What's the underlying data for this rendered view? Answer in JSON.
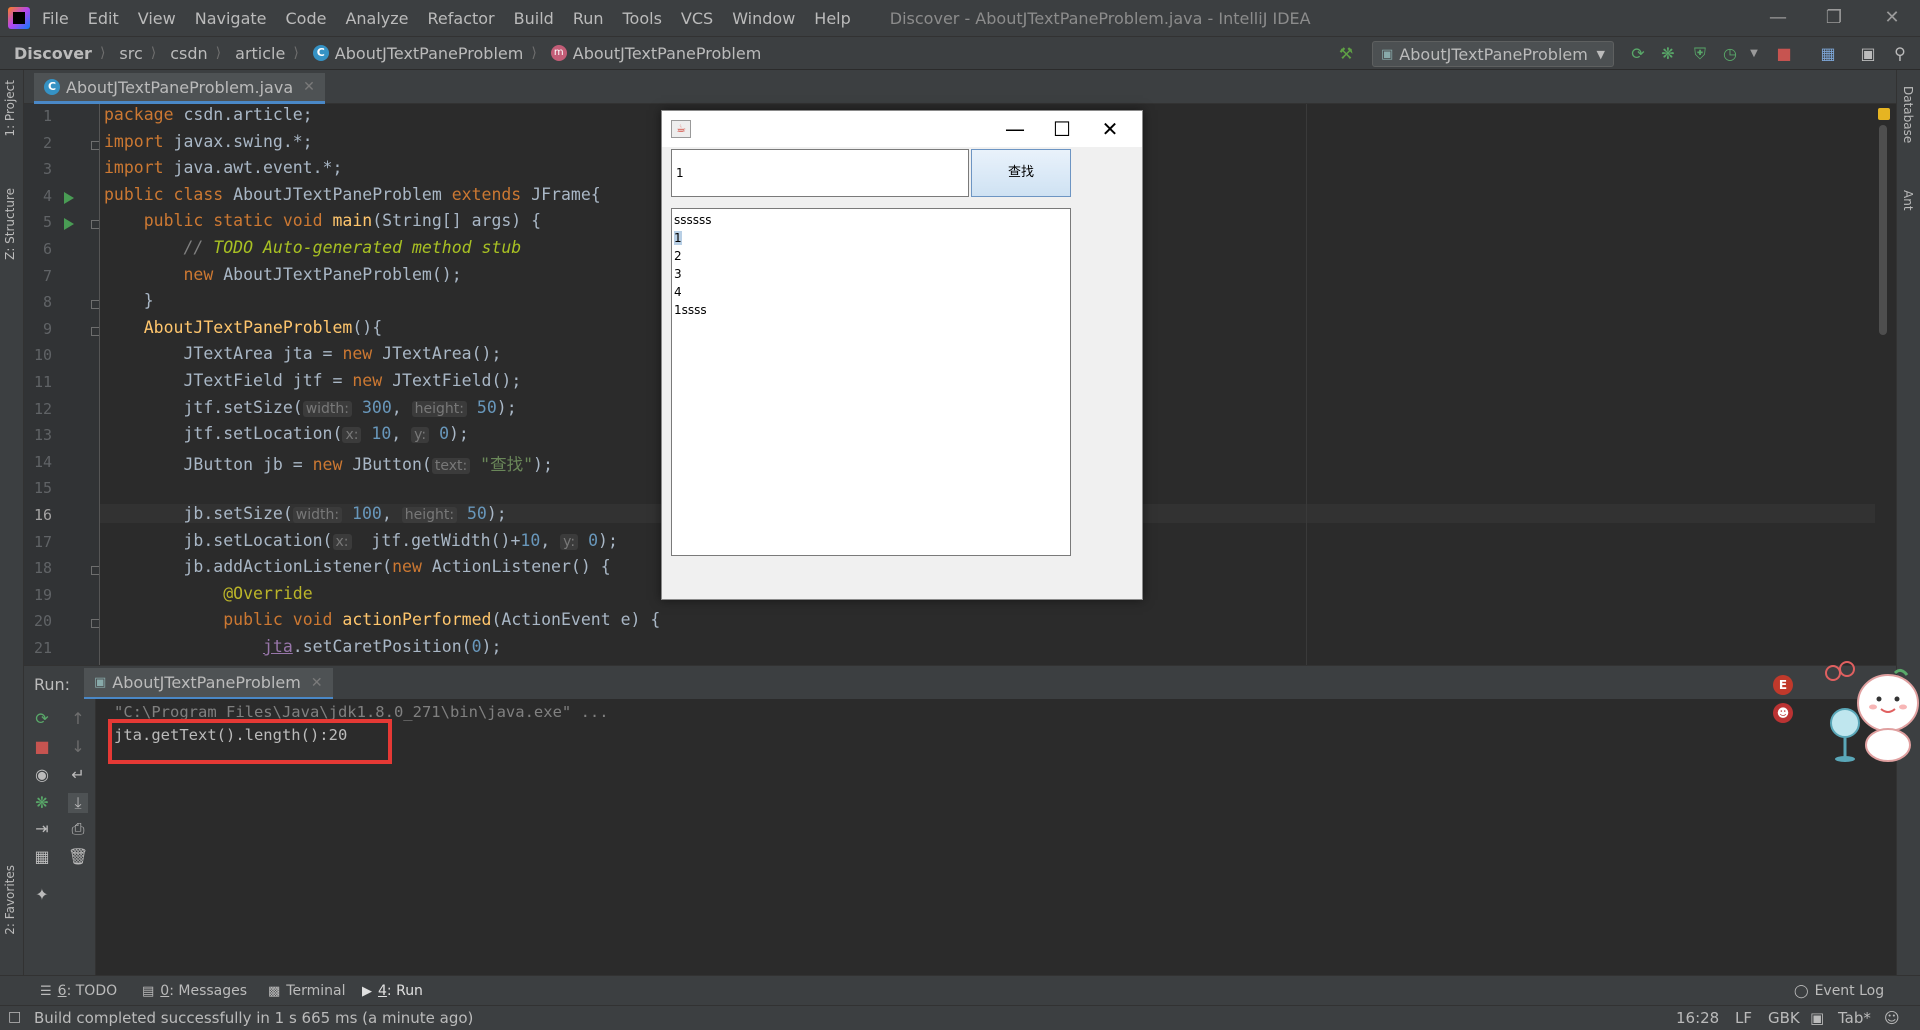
{
  "menubar": {
    "items": [
      "File",
      "Edit",
      "View",
      "Navigate",
      "Code",
      "Analyze",
      "Refactor",
      "Build",
      "Run",
      "Tools",
      "VCS",
      "Window",
      "Help"
    ],
    "window_title": "Discover - AboutJTextPaneProblem.java - IntelliJ IDEA"
  },
  "breadcrumb": [
    "Discover",
    "src",
    "csdn",
    "article",
    "AboutJTextPaneProblem",
    "AboutJTextPaneProblem"
  ],
  "toolbar": {
    "run_config": "AboutJTextPaneProblem"
  },
  "left_strip": {
    "project": "1: Project",
    "structure": "Z: Structure",
    "favorites": "2: Favorites"
  },
  "right_strip": {
    "database": "Database",
    "ant": "Ant"
  },
  "editor": {
    "tab_label": "AboutJTextPaneProblem.java",
    "line_numbers": [
      "1",
      "2",
      "3",
      "4",
      "5",
      "6",
      "7",
      "8",
      "9",
      "10",
      "11",
      "12",
      "13",
      "14",
      "15",
      "16",
      "17",
      "18",
      "19",
      "20",
      "21"
    ],
    "current_line": 16,
    "lines": [
      {
        "kw1": "package",
        "rest": " csdn.article;"
      },
      {
        "kw1": "import",
        "rest": " javax.swing.*;"
      },
      {
        "kw1": "import",
        "rest": " java.awt.event.*;"
      },
      {
        "kw1": "public class",
        "name": " AboutJTextPaneProblem ",
        "kw2": "extends",
        "rest": " JFrame{"
      },
      {
        "indent": "    ",
        "kw1": "public static void",
        "fn": " main",
        "rest": "(String[] args) {"
      },
      {
        "indent": "        ",
        "comment": "// ",
        "todo": "TODO Auto-generated method stub"
      },
      {
        "indent": "        ",
        "kw1": "new",
        "rest": " AboutJTextPaneProblem();"
      },
      {
        "indent": "    ",
        "rest": "}"
      },
      {
        "indent": "    ",
        "fn": "AboutJTextPaneProblem",
        "rest": "(){"
      },
      {
        "indent": "        ",
        "rest": "JTextArea jta = ",
        "kw1": "new",
        "rest2": " JTextArea();"
      },
      {
        "indent": "        ",
        "rest": "JTextField jtf = ",
        "kw1": "new",
        "rest2": " JTextField();"
      },
      {
        "indent": "        ",
        "rest": "jtf.setSize(",
        "h1": "width:",
        "n1": "300",
        "sep": ", ",
        "h2": "height:",
        "n2": "50",
        "end": ");"
      },
      {
        "indent": "        ",
        "rest": "jtf.setLocation(",
        "h1": "x:",
        "n1": "10",
        "sep": ", ",
        "h2": "y:",
        "n2": "0",
        "end": ");"
      },
      {
        "indent": "        ",
        "rest": "JButton jb = ",
        "kw1": "new",
        "rest2": " JButton(",
        "h1": "text:",
        "s1": "\"查找\"",
        "end": ");"
      },
      {
        "rest": ""
      },
      {
        "indent": "        ",
        "rest": "jb.setSize(",
        "h1": "width:",
        "n1": "100",
        "sep": ", ",
        "h2": "height:",
        "n2": "50",
        "end": ");"
      },
      {
        "indent": "        ",
        "rest": "jb.setLocation(",
        "h1": "x:",
        "mid": " jtf.getWidth()+",
        "n1": "10",
        "sep": ", ",
        "h2": "y:",
        "n2": "0",
        "end": ");"
      },
      {
        "indent": "        ",
        "rest": "jb.addActionListener(",
        "kw1": "new",
        "rest2": " ActionListener() {"
      },
      {
        "indent": "            ",
        "ann": "@Override"
      },
      {
        "indent": "            ",
        "kw1": "public void",
        "fn": " actionPerformed",
        "rest": "(ActionEvent e) {"
      },
      {
        "indent": "                ",
        "field": "jta",
        "rest": ".setCaretPosition(",
        "n1": "0",
        "end": ");"
      }
    ]
  },
  "swing_window": {
    "text_field_value": "1",
    "button_label": "查找",
    "text_area_lines": [
      "ssssss",
      "1",
      "2",
      "3",
      "4",
      "1ssss"
    ],
    "selected_line": "1"
  },
  "run_panel": {
    "label": "Run:",
    "tab_label": "AboutJTextPaneProblem",
    "command": "\"C:\\Program Files\\Java\\jdk1.8.0_271\\bin\\java.exe\" ...",
    "output": "jta.getText().length():20"
  },
  "bottom_tabs": {
    "todo_key": "6",
    "todo": ": TODO",
    "messages_key": "0",
    "messages": ": Messages",
    "terminal": "Terminal",
    "run_key": "4",
    "run": ": Run",
    "event_log": "Event Log"
  },
  "statusbar": {
    "message": "Build completed successfully in 1 s 665 ms (a minute ago)",
    "position": "16:28",
    "line_sep": "LF",
    "encoding": "GBK",
    "indent": "Tab*"
  },
  "colors": {
    "keyword": "#cc7832",
    "function": "#ffc66d",
    "string": "#6a8759",
    "number": "#6897bb",
    "highlight_box": "#e53935",
    "accent": "#4a88c7"
  }
}
